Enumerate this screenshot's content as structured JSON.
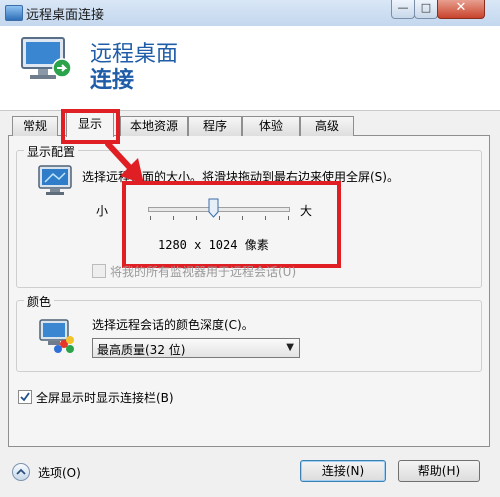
{
  "window": {
    "title": "远程桌面连接",
    "min_glyph": "—",
    "max_glyph": "□",
    "close_glyph": "✕"
  },
  "header": {
    "line1": "远程桌面",
    "line2": "连接"
  },
  "tabs": [
    {
      "label": "常规",
      "active": false
    },
    {
      "label": "显示",
      "active": true
    },
    {
      "label": "本地资源",
      "active": false
    },
    {
      "label": "程序",
      "active": false
    },
    {
      "label": "体验",
      "active": false
    },
    {
      "label": "高级",
      "active": false
    }
  ],
  "display_config": {
    "group_title": "显示配置",
    "description": "选择远程桌面的大小。将滑块拖动到最右边来使用全屏(S)。",
    "slider_min_label": "小",
    "slider_max_label": "大",
    "resolution": "1280 x 1024 像素",
    "slider_level": 0.45,
    "use_all_monitors_label": "将我的所有监视器用于远程会话(U)",
    "use_all_monitors_checked": false
  },
  "color": {
    "group_title": "颜色",
    "description": "选择远程会话的颜色深度(C)。",
    "depth_selected": "最高质量(32 位)"
  },
  "fullscreen_bar": {
    "label": "全屏显示时显示连接栏(B)",
    "checked": true
  },
  "footer": {
    "options_label": "选项(O)",
    "connect_label": "连接(N)",
    "help_label": "帮助(H)"
  },
  "annotation_color": "#e01f24",
  "icons": [
    "remote-desktop-monitor-icon",
    "display-monitor-icon",
    "color-palette-icon",
    "options-toggle-icon",
    "annotation-arrow-icon"
  ]
}
